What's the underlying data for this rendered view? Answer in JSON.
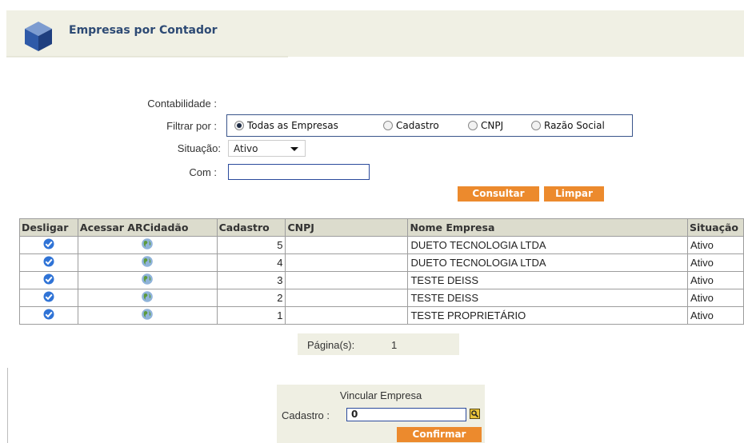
{
  "header": {
    "title": "Empresas por Contador",
    "logo_icon": "cube-icon"
  },
  "form": {
    "contabilidade_label": "Contabilidade :",
    "filtrar_label": "Filtrar por :",
    "filter_options": [
      "Todas as Empresas",
      "Cadastro",
      "CNPJ",
      "Razão Social"
    ],
    "filter_selected": "Todas as Empresas",
    "situacao_label": "Situação:",
    "situacao_value": "Ativo",
    "com_label": "Com :",
    "com_value": "",
    "consultar_label": "Consultar",
    "limpar_label": "Limpar"
  },
  "table": {
    "headers": [
      "Desligar",
      "Acessar ARCidadão",
      "Cadastro",
      "CNPJ",
      "Nome Empresa",
      "Situação"
    ],
    "rows": [
      {
        "cadastro": "5",
        "cnpj": "",
        "nome": "DUETO TECNOLOGIA LTDA",
        "situacao": "Ativo"
      },
      {
        "cadastro": "4",
        "cnpj": "",
        "nome": "DUETO TECNOLOGIA LTDA",
        "situacao": "Ativo"
      },
      {
        "cadastro": "3",
        "cnpj": "",
        "nome": "TESTE DEISS",
        "situacao": "Ativo"
      },
      {
        "cadastro": "2",
        "cnpj": "",
        "nome": "TESTE DEISS",
        "situacao": "Ativo"
      },
      {
        "cadastro": "1",
        "cnpj": "",
        "nome": "TESTE PROPRIETÁRIO",
        "situacao": "Ativo"
      }
    ],
    "desligar_icon": "unlink-check-icon",
    "acessar_icon": "globe-icon"
  },
  "pager": {
    "label": "Página(s):",
    "current": "1"
  },
  "vincular": {
    "title": "Vincular Empresa",
    "cadastro_label": "Cadastro :",
    "cadastro_value": "0",
    "lookup_icon": "lookup-icon",
    "confirm_label": "Confirmar"
  },
  "colors": {
    "accent": "#ec8a2d",
    "header_bg": "#f0f0e4",
    "title": "#2d4a74",
    "table_header": "#dcdccd"
  }
}
